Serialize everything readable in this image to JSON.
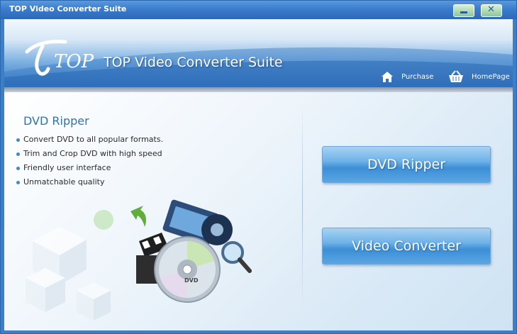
{
  "window": {
    "title": "TOP Video Converter Suite"
  },
  "header": {
    "logo_text": "TOP",
    "brand_title": "TOP Video Converter Suite",
    "links": {
      "purchase": "Purchase",
      "homepage": "HomePage"
    }
  },
  "panel": {
    "section_title": "DVD Ripper",
    "features": [
      "Convert DVD to all popular formats.",
      "Trim and Crop DVD with high speed",
      "Friendly user interface",
      "Unmatchable quality"
    ],
    "disc_label": "DVD"
  },
  "actions": {
    "dvd_ripper": "DVD Ripper",
    "video_converter": "Video Converter"
  },
  "colors": {
    "titlebar": "#3b7ccc",
    "accent": "#2a75b8",
    "button": "#5aa6e4"
  }
}
